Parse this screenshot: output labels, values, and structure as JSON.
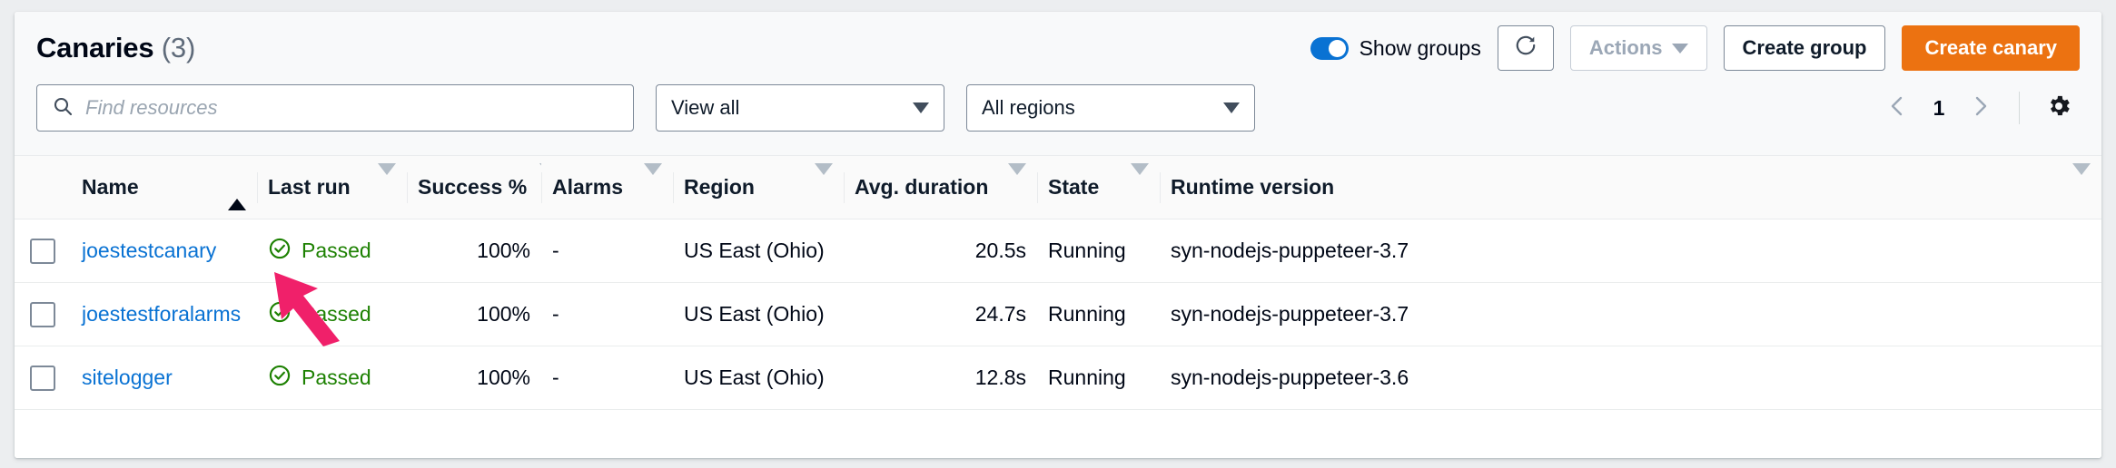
{
  "header": {
    "title": "Canaries",
    "count": "(3)",
    "show_groups_label": "Show groups",
    "refresh_icon": "refresh-icon",
    "actions_label": "Actions",
    "create_group_label": "Create group",
    "create_canary_label": "Create canary"
  },
  "filters": {
    "search_placeholder": "Find resources",
    "search_value": "",
    "search_icon": "search-icon",
    "view_select": "View all",
    "region_select": "All regions",
    "pagination": {
      "prev_icon": "chevron-left-icon",
      "page": "1",
      "next_icon": "chevron-right-icon"
    },
    "preferences_icon": "gear-icon"
  },
  "table": {
    "columns": [
      {
        "label": "Name",
        "sort": "asc"
      },
      {
        "label": "Last run",
        "sort": "none"
      },
      {
        "label": "Success %",
        "sort": "none"
      },
      {
        "label": "Alarms",
        "sort": "none"
      },
      {
        "label": "Region",
        "sort": "none"
      },
      {
        "label": "Avg. duration",
        "sort": "none"
      },
      {
        "label": "State",
        "sort": "none"
      },
      {
        "label": "Runtime version",
        "sort": "none"
      }
    ],
    "rows": [
      {
        "name": "joestestcanary",
        "last_run": "Passed",
        "success": "100%",
        "alarms": "-",
        "region": "US East (Ohio)",
        "duration": "20.5s",
        "state": "Running",
        "runtime": "syn-nodejs-puppeteer-3.7"
      },
      {
        "name": "joestestforalarms",
        "last_run": "Passed",
        "success": "100%",
        "alarms": "-",
        "region": "US East (Ohio)",
        "duration": "24.7s",
        "state": "Running",
        "runtime": "syn-nodejs-puppeteer-3.7"
      },
      {
        "name": "sitelogger",
        "last_run": "Passed",
        "success": "100%",
        "alarms": "-",
        "region": "US East (Ohio)",
        "duration": "12.8s",
        "state": "Running",
        "runtime": "syn-nodejs-puppeteer-3.6"
      }
    ]
  },
  "annotation": {
    "arrow_icon": "pointer-arrow-annotation",
    "color": "#f0206a"
  },
  "colors": {
    "primary_button": "#ec7211",
    "link": "#0972d3",
    "toggle_on": "#0972d3",
    "status_pass": "#1d8102",
    "annotation": "#f0206a"
  }
}
